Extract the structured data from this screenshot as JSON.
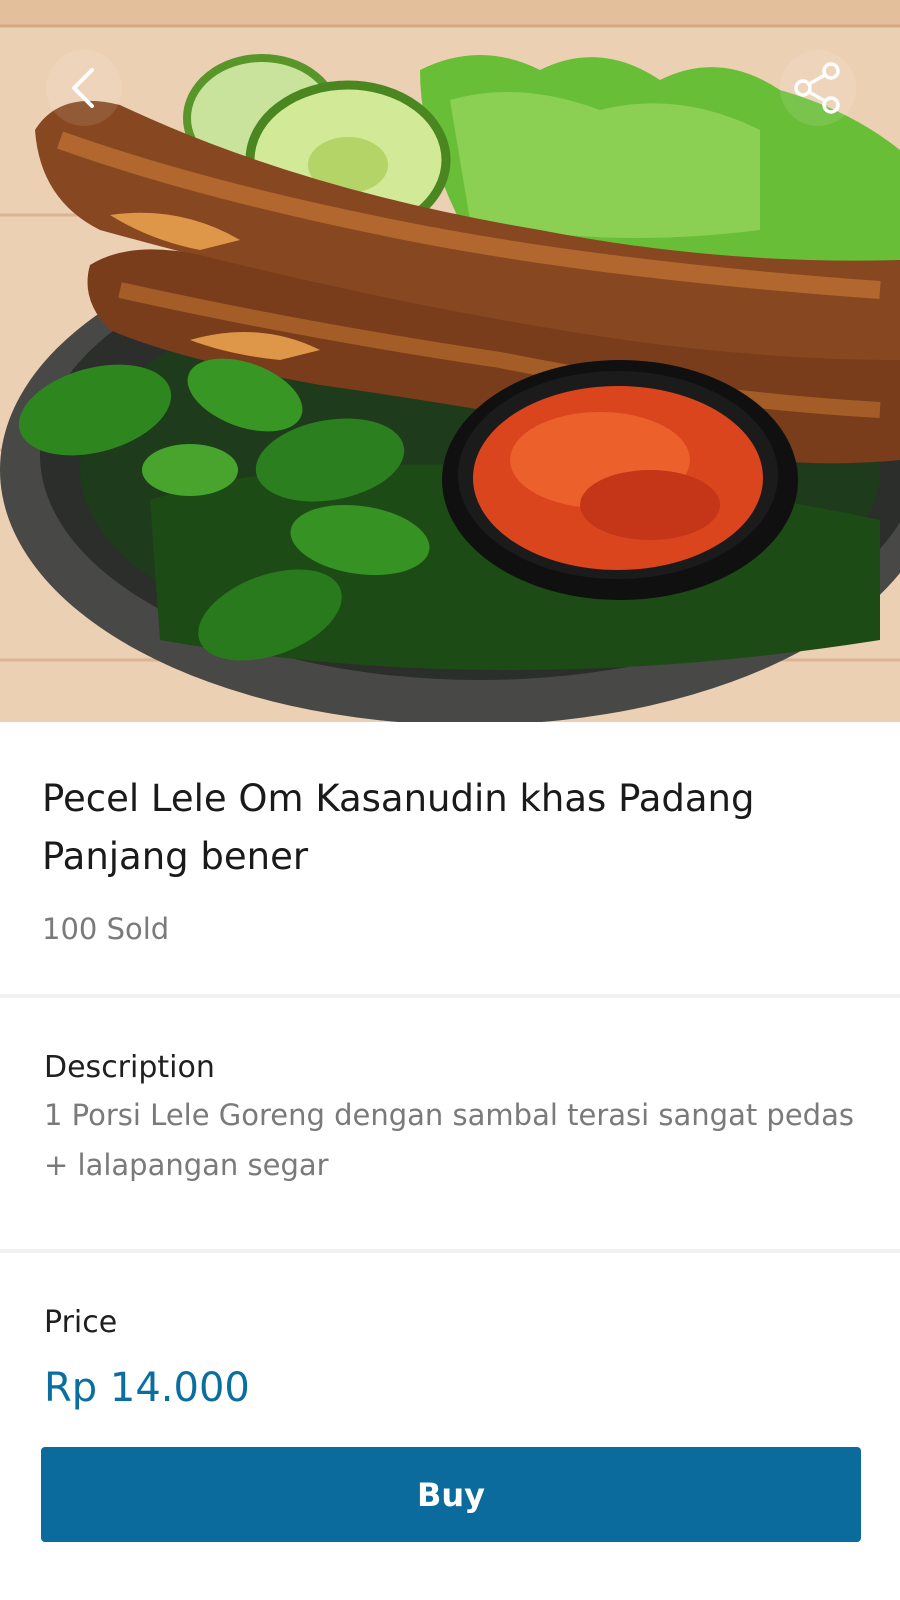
{
  "header": {
    "back_icon": "chevron-left-icon",
    "share_icon": "share-icon"
  },
  "product": {
    "title": "Pecel Lele Om Kasanudin khas Padang Panjang bener",
    "sold": "100 Sold"
  },
  "description": {
    "label": "Description",
    "text": "1 Porsi Lele Goreng dengan sambal terasi sangat pedas + lalapangan segar"
  },
  "price": {
    "label": "Price",
    "value": "Rp 14.000"
  },
  "actions": {
    "buy_label": "Buy"
  },
  "colors": {
    "accent": "#0b6b9c",
    "price": "#0a6fa0",
    "muted_text": "#7a7a7a",
    "divider": "#f1f1f1"
  }
}
